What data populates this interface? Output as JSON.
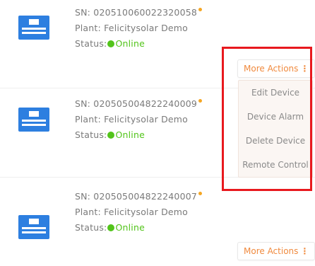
{
  "devices": [
    {
      "sn_label": "SN:",
      "sn": "020510060022320058",
      "plant_label": "Plant:",
      "plant": "Felicitysolar Demo",
      "status_label": "Status:",
      "status": "Online"
    },
    {
      "sn_label": "SN:",
      "sn": "020505004822240009",
      "plant_label": "Plant:",
      "plant": "Felicitysolar Demo",
      "status_label": "Status:",
      "status": "Online"
    },
    {
      "sn_label": "SN:",
      "sn": "020505004822240007",
      "plant_label": "Plant:",
      "plant": "Felicitysolar Demo",
      "status_label": "Status:",
      "status": "Online"
    }
  ],
  "more_actions_label": "More Actions",
  "menu": [
    "Edit Device",
    "Device Alarm",
    "Delete Device",
    "Remote Control"
  ],
  "colors": {
    "accent": "#f08a3e",
    "online": "#52c41a",
    "sn_dot": "#f5a623",
    "icon_blue": "#2d7fe0",
    "highlight": "#e8191e"
  }
}
